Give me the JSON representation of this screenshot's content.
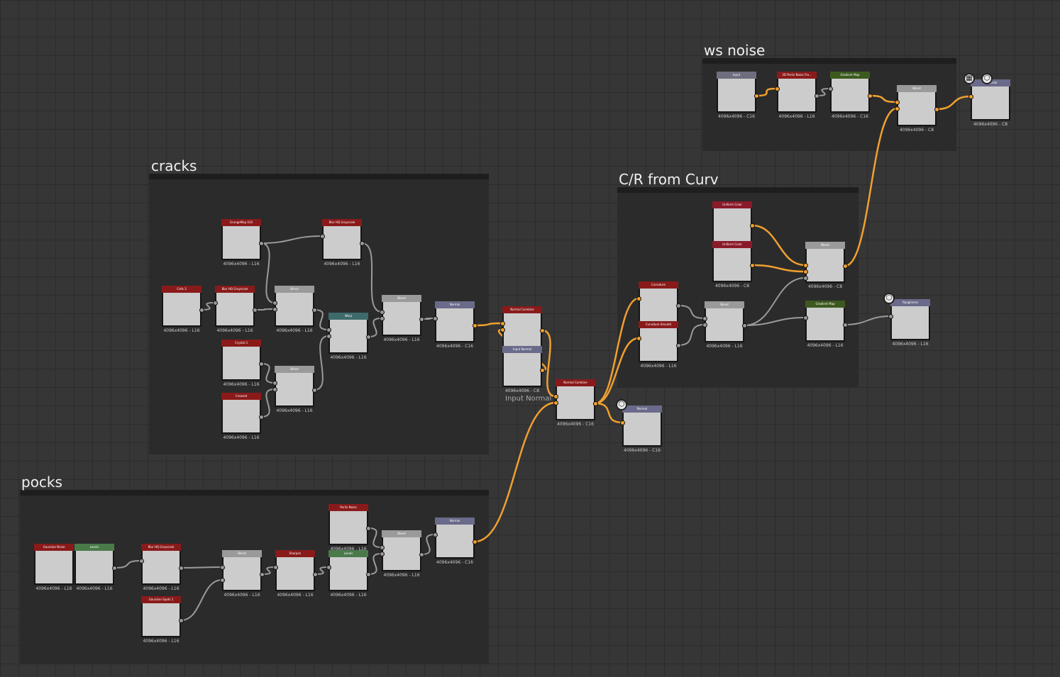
{
  "frames": {
    "ws_noise": {
      "title": "ws noise"
    },
    "cracks": {
      "title": "cracks"
    },
    "cr_from_curv": {
      "title": "C/R from Curv"
    },
    "pocks": {
      "title": "pocks"
    }
  },
  "colors": {
    "wire_grey": "#9a9a9a",
    "wire_orange": "#f0a030"
  },
  "input_normal_label": "Input Normal",
  "badges": {
    "checker": "checker-icon",
    "cube": "cube-icon"
  },
  "nodes": [
    {
      "id": "ws_input",
      "title": "Input",
      "res": "4096x4096 - C16",
      "hdr": "#6e6e80",
      "tex": "tex-rainbow"
    },
    {
      "id": "ws_perlin",
      "title": "3D Perlin Noise Fra...",
      "res": "4096x4096 - L16",
      "hdr": "#8a1a1a",
      "tex": "tex-midnoise"
    },
    {
      "id": "ws_gradmap",
      "title": "Gradient Map",
      "res": "4096x4096 - C16",
      "hdr": "#3d5a1e",
      "tex": "tex-midnoise"
    },
    {
      "id": "ws_blend",
      "title": "Blend",
      "res": "4096x4096 - C8",
      "hdr": "#9a9a9a",
      "tex": "tex-olive2"
    },
    {
      "id": "ws_out",
      "title": "Basecolor",
      "res": "4096x4096 - C8",
      "hdr": "#6a6a8a",
      "tex": "tex-olive"
    },
    {
      "id": "cr_grunge",
      "title": "GrungeMap 010",
      "res": "4096x4096 - L16",
      "hdr": "#8a1a1a",
      "tex": "tex-bw"
    },
    {
      "id": "cr_blurhq1",
      "title": "Blur HQ Grayscale",
      "res": "4096x4096 - L16",
      "hdr": "#8a1a1a",
      "tex": "tex-bw"
    },
    {
      "id": "cr_cells",
      "title": "Cells 3",
      "res": "4096x4096 - L16",
      "hdr": "#8a1a1a",
      "tex": "tex-white"
    },
    {
      "id": "cr_blurhq2",
      "title": "Blur HQ Grayscale",
      "res": "4096x4096 - L16",
      "hdr": "#8a1a1a",
      "tex": "tex-white"
    },
    {
      "id": "cr_blend1",
      "title": "Blend",
      "res": "4096x4096 - L16",
      "hdr": "#9a9a9a",
      "tex": "tex-white"
    },
    {
      "id": "cr_warp",
      "title": "Warp",
      "res": "4096x4096 - L16",
      "hdr": "#3e6a6a",
      "tex": "tex-white"
    },
    {
      "id": "cr_blend2",
      "title": "Blend",
      "res": "4096x4096 - L16",
      "hdr": "#9a9a9a",
      "tex": "tex-white"
    },
    {
      "id": "cr_normal",
      "title": "Normal",
      "res": "4096x4096 - C16",
      "hdr": "#6a6a8a",
      "tex": "tex-flat-normal"
    },
    {
      "id": "cr_crystal",
      "title": "Crystal 3",
      "res": "4096x4096 - L16",
      "hdr": "#8a1a1a",
      "tex": "tex-stripe"
    },
    {
      "id": "cr_blend3",
      "title": "Blend",
      "res": "4096x4096 - L16",
      "hdr": "#9a9a9a",
      "tex": "tex-stripe"
    },
    {
      "id": "cr_creased",
      "title": "Creased",
      "res": "4096x4096 - L16",
      "hdr": "#8a1a1a",
      "tex": "tex-stripe"
    },
    {
      "id": "nc1",
      "title": "Normal Combine",
      "res": "4096x4096 - C16",
      "hdr": "#8a1a1a",
      "tex": "tex-normal"
    },
    {
      "id": "input_normal",
      "title": "Input Normal",
      "res": "4096x4096 - C8",
      "hdr": "#6a6a8a",
      "tex": "tex-normal"
    },
    {
      "id": "nc2",
      "title": "Normal Combine",
      "res": "4096x4096 - C16",
      "hdr": "#8a1a1a",
      "tex": "tex-normal"
    },
    {
      "id": "out_normal",
      "title": "Normal",
      "res": "4096x4096 - C16",
      "hdr": "#6a6a8a",
      "tex": "tex-normal"
    },
    {
      "id": "cv_uni1",
      "title": "Uniform Color",
      "res": "4096x4096 - C8",
      "hdr": "#8a1a2a",
      "tex": "tex-olive2"
    },
    {
      "id": "cv_uni2",
      "title": "Uniform Color",
      "res": "4096x4096 - C8",
      "hdr": "#8a1a2a",
      "tex": "tex-olive"
    },
    {
      "id": "cv_blend1",
      "title": "Blend",
      "res": "4096x4096 - C8",
      "hdr": "#9a9a9a",
      "tex": "tex-olive"
    },
    {
      "id": "cv_curv",
      "title": "Curvature",
      "res": "",
      "hdr": "#8a1a1a",
      "tex": "tex-grey"
    },
    {
      "id": "cv_curvsmooth",
      "title": "Curvature Smooth",
      "res": "4096x4096 - L16",
      "hdr": "#8a1a1a",
      "tex": "tex-noise"
    },
    {
      "id": "cv_blend2",
      "title": "Blend",
      "res": "4096x4096 - L16",
      "hdr": "#9a9a9a",
      "tex": "tex-noise"
    },
    {
      "id": "cv_gradmap",
      "title": "Gradient Map",
      "res": "4096x4096 - L16",
      "hdr": "#3d5a1e",
      "tex": "tex-lightnoise"
    },
    {
      "id": "cv_rough",
      "title": "Roughness",
      "res": "4096x4096 - L16",
      "hdr": "#6a6a8a",
      "tex": "tex-lightnoise"
    },
    {
      "id": "pk_gauss",
      "title": "Gaussian Noise",
      "res": "4096x4096 - L16",
      "hdr": "#8a1a1a",
      "tex": "tex-noise"
    },
    {
      "id": "pk_levels1",
      "title": "Levels",
      "res": "4096x4096 - L16",
      "hdr": "#4a7a4a",
      "tex": "tex-bw"
    },
    {
      "id": "pk_blurhq",
      "title": "Blur HQ Grayscale",
      "res": "4096x4096 - L16",
      "hdr": "#8a1a1a",
      "tex": "tex-noise"
    },
    {
      "id": "pk_spots",
      "title": "Gaussian Spots 1",
      "res": "4096x4096 - L16",
      "hdr": "#8a1a1a",
      "tex": "tex-dark"
    },
    {
      "id": "pk_blend1",
      "title": "Blend",
      "res": "4096x4096 - L16",
      "hdr": "#9a9a9a",
      "tex": "tex-black"
    },
    {
      "id": "pk_sharpen",
      "title": "Sharpen",
      "res": "4096x4096 - L16",
      "hdr": "#8a1a1a",
      "tex": "tex-white"
    },
    {
      "id": "pk_perlin",
      "title": "Perlin Noise",
      "res": "4096x4096 - L16",
      "hdr": "#8a1a1a",
      "tex": "tex-noise"
    },
    {
      "id": "pk_levels2",
      "title": "Levels",
      "res": "4096x4096 - L16",
      "hdr": "#4a7a4a",
      "tex": "tex-lightnoise"
    },
    {
      "id": "pk_blend2",
      "title": "Blend",
      "res": "4096x4096 - L16",
      "hdr": "#9a9a9a",
      "tex": "tex-white"
    },
    {
      "id": "pk_normal",
      "title": "Normal",
      "res": "4096x4096 - C16",
      "hdr": "#6a6a8a",
      "tex": "tex-flat-normal"
    }
  ]
}
